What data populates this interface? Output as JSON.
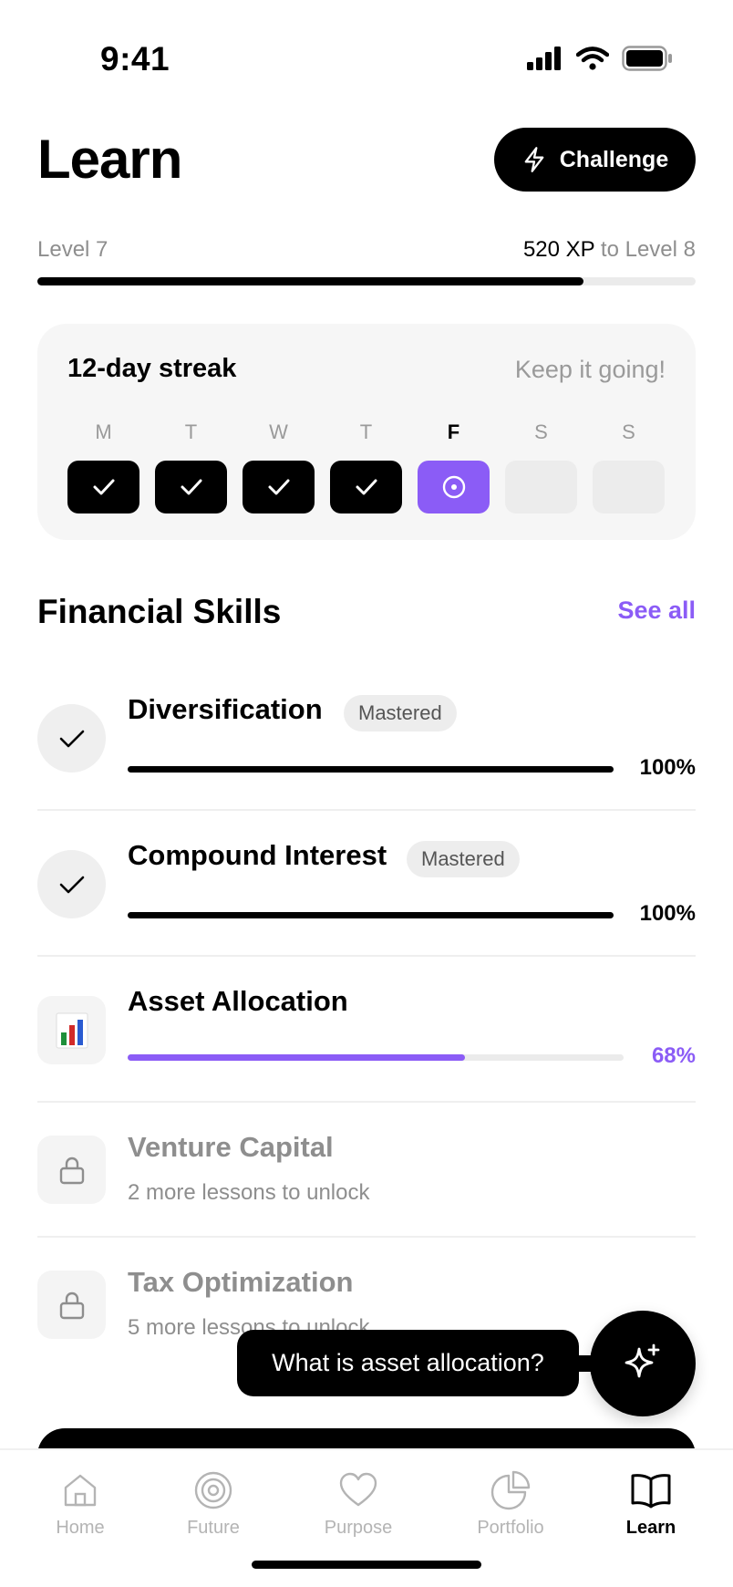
{
  "status_bar": {
    "time": "9:41"
  },
  "header": {
    "title": "Learn",
    "challenge_label": "Challenge"
  },
  "level": {
    "current": "Level 7",
    "xp": "520 XP",
    "to_next": "to Level 8",
    "progress": 0.83
  },
  "streak": {
    "title": "12-day streak",
    "subtitle": "Keep it going!",
    "days": [
      {
        "letter": "M",
        "state": "done"
      },
      {
        "letter": "T",
        "state": "done"
      },
      {
        "letter": "W",
        "state": "done"
      },
      {
        "letter": "T",
        "state": "done"
      },
      {
        "letter": "F",
        "state": "current"
      },
      {
        "letter": "S",
        "state": "empty"
      },
      {
        "letter": "S",
        "state": "empty"
      }
    ]
  },
  "skills_section": {
    "title": "Financial Skills",
    "see_all": "See all",
    "skills": [
      {
        "name": "Diversification",
        "badge": "Mastered",
        "progress": 1.0,
        "percent": "100%",
        "icon": "check-icon"
      },
      {
        "name": "Compound Interest",
        "badge": "Mastered",
        "progress": 1.0,
        "percent": "100%",
        "icon": "check-icon"
      },
      {
        "name": "Asset Allocation",
        "progress": 0.68,
        "percent": "68%",
        "icon": "bar-chart-icon"
      },
      {
        "name": "Venture Capital",
        "subtitle": "2 more lessons to unlock",
        "icon": "lock-icon"
      },
      {
        "name": "Tax Optimization",
        "subtitle": "5 more lessons to unlock",
        "icon": "lock-icon"
      }
    ]
  },
  "assistant": {
    "bubble_text": "What is asset allocation?",
    "icon": "sparkle-icon"
  },
  "colors": {
    "accent": "#8b5cf6",
    "text": "#000000",
    "muted": "#8e8e8e"
  },
  "tabbar": {
    "tabs": [
      {
        "label": "Home",
        "icon": "home-icon",
        "active": false
      },
      {
        "label": "Future",
        "icon": "target-icon",
        "active": false
      },
      {
        "label": "Purpose",
        "icon": "heart-icon",
        "active": false
      },
      {
        "label": "Portfolio",
        "icon": "pie-chart-icon",
        "active": false
      },
      {
        "label": "Learn",
        "icon": "book-icon",
        "active": true
      }
    ]
  }
}
